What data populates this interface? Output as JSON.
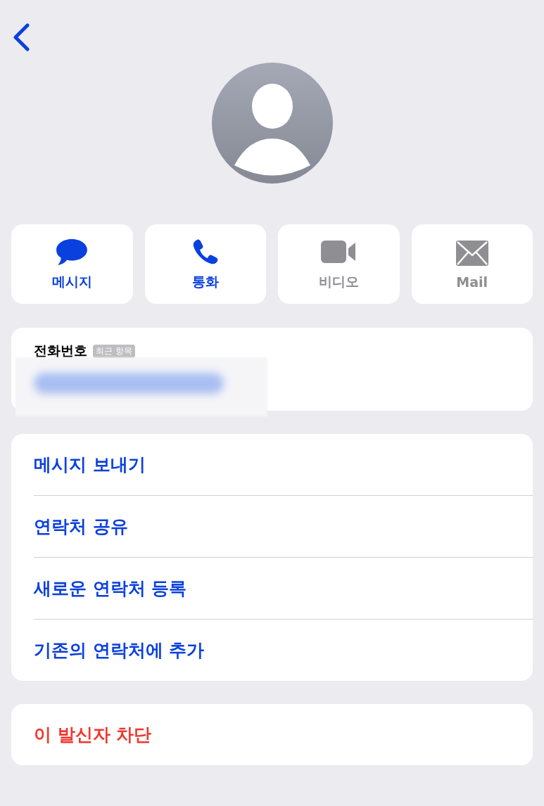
{
  "actions": [
    {
      "kind": "message",
      "label": "메시지",
      "disabled": false
    },
    {
      "kind": "call",
      "label": "통화",
      "disabled": false
    },
    {
      "kind": "video",
      "label": "비디오",
      "disabled": true
    },
    {
      "kind": "mail",
      "label": "Mail",
      "disabled": true
    }
  ],
  "phone": {
    "label": "전화번호",
    "badge": "최근 항목",
    "redacted": true
  },
  "options": [
    "메시지 보내기",
    "연락처 공유",
    "새로운 연락처 등록",
    "기존의 연락처에 추가"
  ],
  "danger_options": [
    "이 발신자 차단"
  ]
}
